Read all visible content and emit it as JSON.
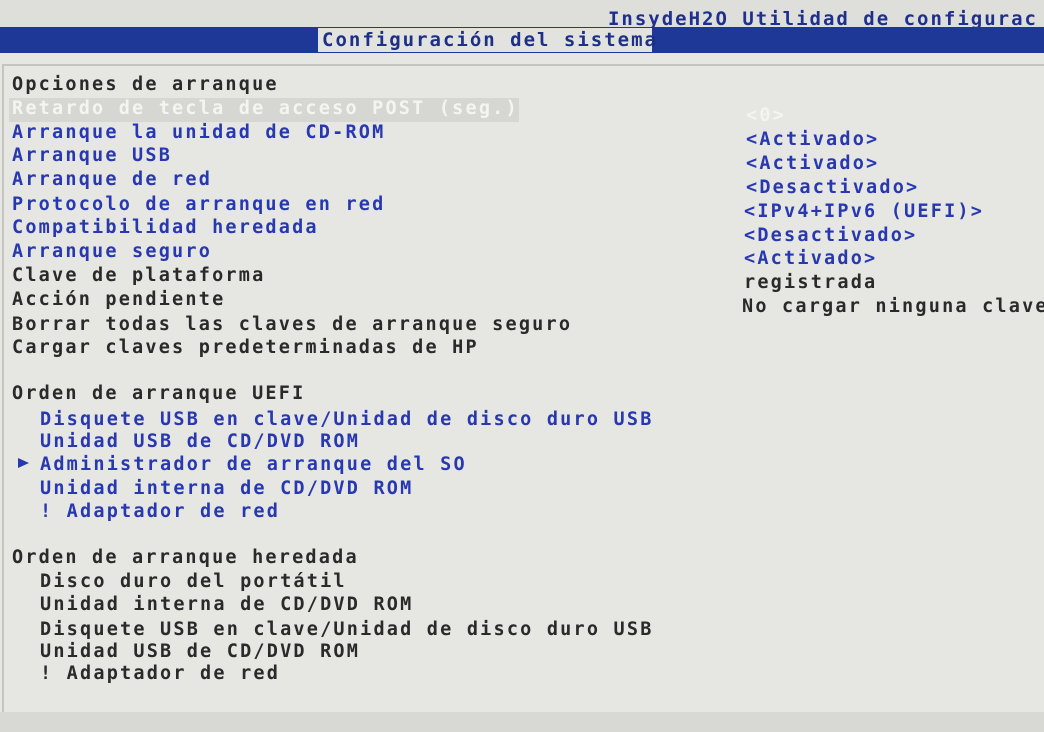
{
  "header": {
    "product_title": "InsydeH2O Utilidad de configurac",
    "active_tab": "Configuración del sistema"
  },
  "boot_options": {
    "section_title": "Opciones de arranque",
    "items": [
      {
        "label": "Retardo de tecla de acceso POST (seg.)",
        "value": "<0>"
      },
      {
        "label": "Arranque la unidad de CD-ROM",
        "value": "<Activado>"
      },
      {
        "label": "Arranque USB",
        "value": "<Activado>"
      },
      {
        "label": "Arranque de red",
        "value": "<Desactivado>"
      },
      {
        "label": "Protocolo de arranque en red",
        "value": "<IPv4+IPv6 (UEFI)>"
      },
      {
        "label": "Compatibilidad heredada",
        "value": "<Desactivado>"
      },
      {
        "label": "Arranque seguro",
        "value": "<Activado>"
      },
      {
        "label": "Clave de plataforma",
        "value": "registrada"
      },
      {
        "label": "Acción pendiente",
        "value": "No cargar ninguna clave"
      },
      {
        "label": "Borrar todas las claves de arranque seguro"
      },
      {
        "label": "Cargar claves predeterminadas de HP"
      }
    ]
  },
  "uefi_order": {
    "section_title": "Orden de arranque UEFI",
    "items": [
      "Disquete USB en clave/Unidad de disco duro USB",
      "Unidad USB de CD/DVD ROM",
      "Administrador de arranque del SO",
      "Unidad interna de CD/DVD ROM",
      "! Adaptador de red"
    ]
  },
  "legacy_order": {
    "section_title": "Orden de arranque heredada",
    "items": [
      "Disco duro del portátil",
      "Unidad interna de CD/DVD ROM",
      "Disquete USB en clave/Unidad de disco duro USB",
      "Unidad USB de CD/DVD ROM",
      "! Adaptador de red"
    ]
  },
  "colors": {
    "accent_blue": "#2738b0",
    "tab_bar": "#1d3896",
    "background": "#e6e6e3"
  }
}
